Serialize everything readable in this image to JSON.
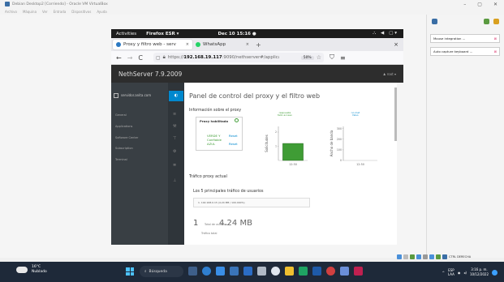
{
  "vbox": {
    "title": "Debian Desktop2 [Corriendo] - Oracle VM VirtualBox",
    "menu": [
      "Archivo",
      "Máquina",
      "Ver",
      "Entrada",
      "Dispositivos",
      "Ayuda"
    ],
    "win_min": "–",
    "win_max": "▢",
    "win_close": "✕"
  },
  "gnome": {
    "activities": "Activities",
    "app": "Firefox ESR ▾",
    "clock": "Dec 10 15:16 ●",
    "tray_network": "⛬",
    "tray_volume": "◀",
    "tray_power": "▢ ▾"
  },
  "firefox": {
    "tabs": [
      {
        "label": "Proxy y filtro web - serv",
        "color": "#2b79c2"
      },
      {
        "label": "WhatsApp",
        "color": "#25d366"
      }
    ],
    "tab_close": "×",
    "new_tab": "+",
    "window_close": "×",
    "nav_back": "←",
    "nav_forward": "→",
    "nav_reload": "C",
    "url_prefix": "https://",
    "url_host": "192.168.19.117",
    "url_rest": ":9090/nethserver#/applications/n",
    "zoom": "50%",
    "star": "☆",
    "pocket": "⛉",
    "menu": "≡"
  },
  "nethserver": {
    "title": "NethServer 7.9.2009",
    "user": "♟ root ▾",
    "server": "servidor.anita.com",
    "sidebar": [
      "General",
      "Applications",
      "Software Center",
      "Subscription",
      "Terminal"
    ],
    "page_title": "Panel de control del proxy y el filtro web",
    "info_title": "Información sobre el proxy",
    "proxy_enabled": "Proxy habilitado",
    "green_label": "VERDE Y Confiable AZUL",
    "reset1": "Reset",
    "reset2": "Reset",
    "legend_a": "respuesta fallo acceso",
    "legend_b": "no met falso",
    "ylabel_1": "Solicitudes",
    "ylabel_2": "Ancho de banda",
    "traffic_title": "Tráfico proxy actual",
    "top5_title": "Los 5 principales tráfico de usuarios",
    "top_user_row": "1. 192.168.0.15 (4.24 MB / 100.000%)",
    "total_users_num": "1",
    "total_users_label": "Total de usuarios",
    "total_mb": "4.24 MB",
    "total_traffic_label": "Tráfico total"
  },
  "chart_data": [
    {
      "type": "bar",
      "ylabel": "Solicitudes",
      "categories": [
        "12:50"
      ],
      "values": [
        1.2
      ],
      "yticks": [
        "1",
        "2"
      ],
      "ylim": [
        0,
        2.4
      ],
      "color": "#3f9c35"
    },
    {
      "type": "bar",
      "ylabel": "Ancho de banda",
      "categories": [
        "12:50"
      ],
      "values": [
        0
      ],
      "yticks": [
        "0",
        "100",
        "200",
        "300"
      ],
      "ylim": [
        0,
        320
      ],
      "color": "#0088ce"
    }
  ],
  "right_panel": {
    "notifications": [
      "Mouse integration ...",
      "Auto capture keyboard ..."
    ],
    "status_right": "CTRL DERECHA"
  },
  "taskbar": {
    "temp": "16°C",
    "weather": "Nublado",
    "search": "Búsqueda",
    "lang1": "ESP",
    "lang2": "LAA",
    "time": "3:16 p. m.",
    "date": "10/12/2022",
    "chevron": "^"
  }
}
